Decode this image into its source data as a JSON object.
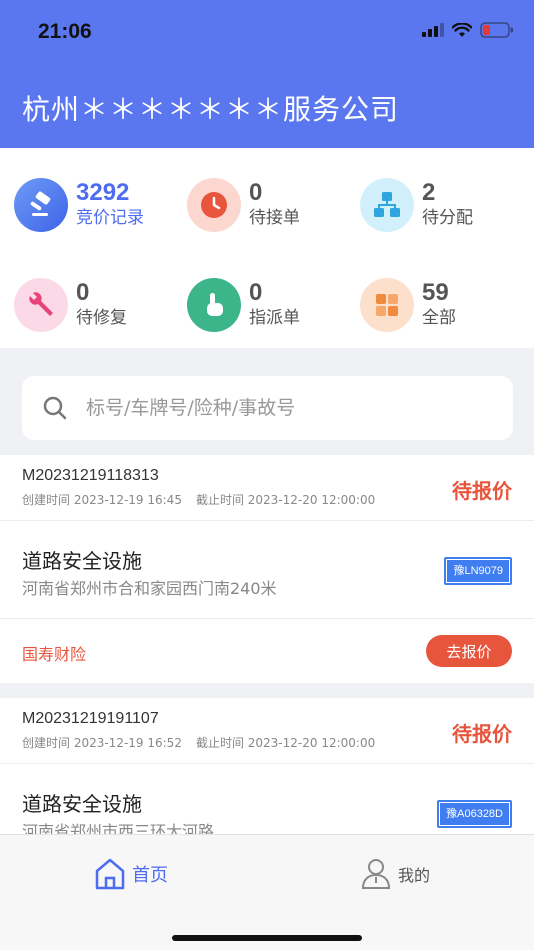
{
  "status_bar": {
    "time": "21:06"
  },
  "header": {
    "company": "杭州＊＊＊＊＊＊＊服务公司"
  },
  "stats": [
    {
      "value": "3292",
      "label": "竞价记录",
      "icon": "gavel-icon",
      "active": true
    },
    {
      "value": "0",
      "label": "待接单",
      "icon": "clock-icon",
      "active": false
    },
    {
      "value": "2",
      "label": "待分配",
      "icon": "hierarchy-icon",
      "active": false
    },
    {
      "value": "0",
      "label": "待修复",
      "icon": "wrench-icon",
      "active": false
    },
    {
      "value": "0",
      "label": "指派单",
      "icon": "pointer-hand-icon",
      "active": false
    },
    {
      "value": "59",
      "label": "全部",
      "icon": "grid-icon",
      "active": false
    }
  ],
  "search": {
    "placeholder": "标号/车牌号/险种/事故号"
  },
  "orders": [
    {
      "id": "M20231219118313",
      "created": "创建时间 2023-12-19 16:45",
      "deadline": "截止时间 2023-12-20 12:00:00",
      "status": "待报价",
      "item": "道路安全设施",
      "address": "河南省郑州市合和家园西门南240米",
      "plate": "豫LN9079",
      "insurer": "国寿财险",
      "action": "去报价"
    },
    {
      "id": "M20231219191107",
      "created": "创建时间 2023-12-19 16:52",
      "deadline": "截止时间 2023-12-20 12:00:00",
      "status": "待报价",
      "item": "道路安全设施",
      "address": "河南省郑州市西三环大河路",
      "plate": "豫A06328D"
    }
  ],
  "tabbar": {
    "home": "首页",
    "mine": "我的"
  },
  "colors": {
    "primary": "#5b77f0",
    "accent": "#e8553d",
    "active_text": "#4d6cf0"
  }
}
